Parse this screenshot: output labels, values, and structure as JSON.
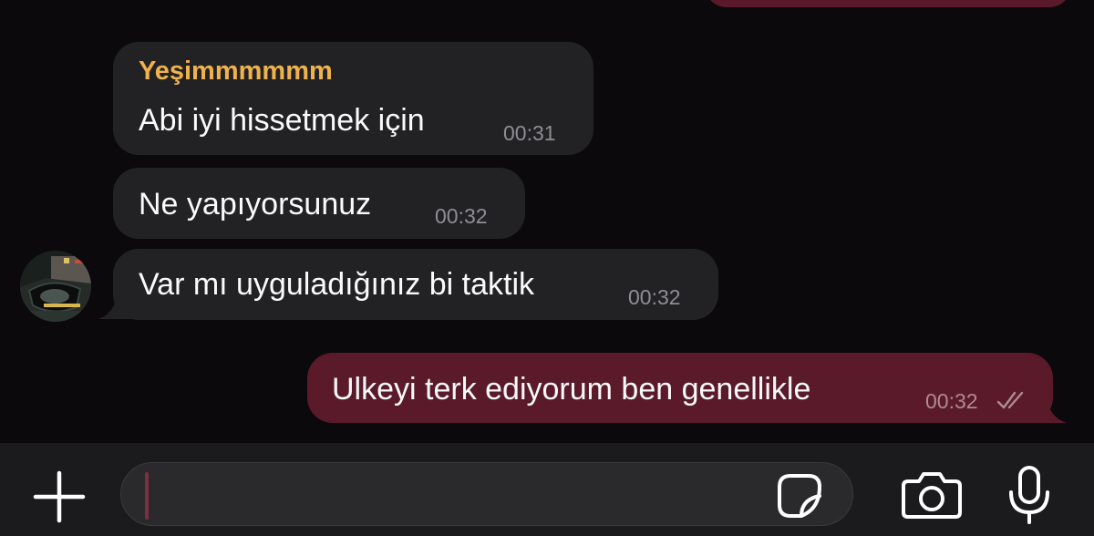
{
  "messages": [
    {
      "sender": "Yeşimmmmmm",
      "text": "Abi iyi hissetmek için",
      "time": "00:31"
    },
    {
      "text": "Ne yapıyorsunuz",
      "time": "00:32"
    },
    {
      "text": "Var mı uyguladığınız bi taktik",
      "time": "00:32"
    },
    {
      "text": "Ulkeyi terk ediyorum ben genellikle",
      "time": "00:32",
      "status": "read"
    }
  ],
  "composer": {
    "placeholder": ""
  },
  "icons": [
    "plus-icon",
    "sticker-icon",
    "camera-icon",
    "microphone-icon",
    "double-check-icon"
  ],
  "colors": {
    "background": "#0b090b",
    "incoming_bubble": "#222224",
    "outgoing_bubble": "#5a1a2a",
    "sender_name": "#f0b24a",
    "caret": "#7d2e42"
  }
}
